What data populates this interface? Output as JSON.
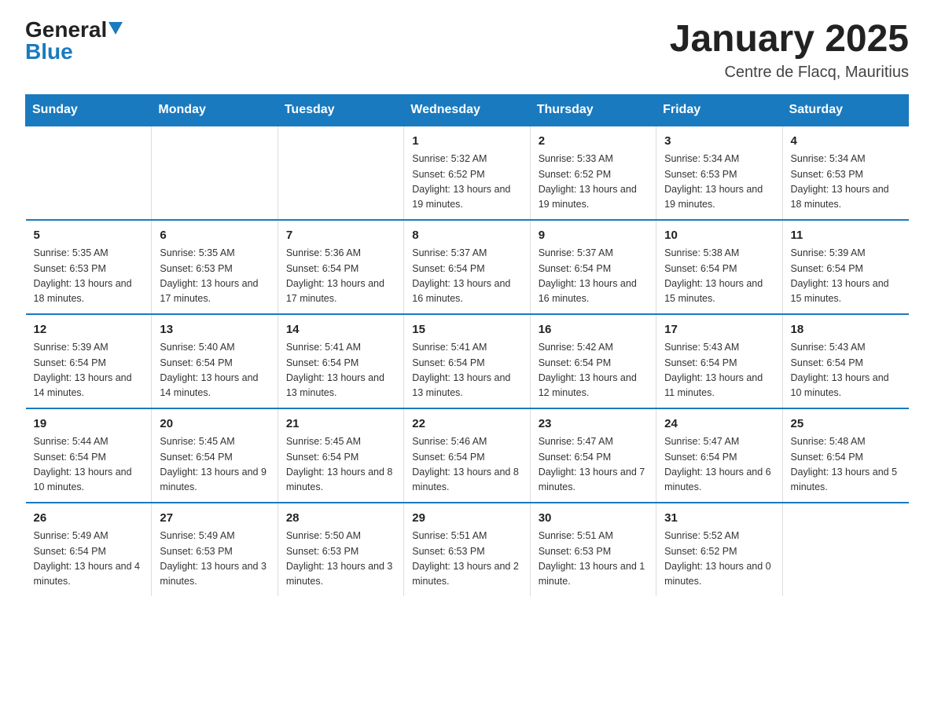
{
  "header": {
    "logo_general": "General",
    "logo_blue": "Blue",
    "title": "January 2025",
    "subtitle": "Centre de Flacq, Mauritius"
  },
  "days_of_week": [
    "Sunday",
    "Monday",
    "Tuesday",
    "Wednesday",
    "Thursday",
    "Friday",
    "Saturday"
  ],
  "weeks": [
    [
      {
        "day": "",
        "info": ""
      },
      {
        "day": "",
        "info": ""
      },
      {
        "day": "",
        "info": ""
      },
      {
        "day": "1",
        "info": "Sunrise: 5:32 AM\nSunset: 6:52 PM\nDaylight: 13 hours and 19 minutes."
      },
      {
        "day": "2",
        "info": "Sunrise: 5:33 AM\nSunset: 6:52 PM\nDaylight: 13 hours and 19 minutes."
      },
      {
        "day": "3",
        "info": "Sunrise: 5:34 AM\nSunset: 6:53 PM\nDaylight: 13 hours and 19 minutes."
      },
      {
        "day": "4",
        "info": "Sunrise: 5:34 AM\nSunset: 6:53 PM\nDaylight: 13 hours and 18 minutes."
      }
    ],
    [
      {
        "day": "5",
        "info": "Sunrise: 5:35 AM\nSunset: 6:53 PM\nDaylight: 13 hours and 18 minutes."
      },
      {
        "day": "6",
        "info": "Sunrise: 5:35 AM\nSunset: 6:53 PM\nDaylight: 13 hours and 17 minutes."
      },
      {
        "day": "7",
        "info": "Sunrise: 5:36 AM\nSunset: 6:54 PM\nDaylight: 13 hours and 17 minutes."
      },
      {
        "day": "8",
        "info": "Sunrise: 5:37 AM\nSunset: 6:54 PM\nDaylight: 13 hours and 16 minutes."
      },
      {
        "day": "9",
        "info": "Sunrise: 5:37 AM\nSunset: 6:54 PM\nDaylight: 13 hours and 16 minutes."
      },
      {
        "day": "10",
        "info": "Sunrise: 5:38 AM\nSunset: 6:54 PM\nDaylight: 13 hours and 15 minutes."
      },
      {
        "day": "11",
        "info": "Sunrise: 5:39 AM\nSunset: 6:54 PM\nDaylight: 13 hours and 15 minutes."
      }
    ],
    [
      {
        "day": "12",
        "info": "Sunrise: 5:39 AM\nSunset: 6:54 PM\nDaylight: 13 hours and 14 minutes."
      },
      {
        "day": "13",
        "info": "Sunrise: 5:40 AM\nSunset: 6:54 PM\nDaylight: 13 hours and 14 minutes."
      },
      {
        "day": "14",
        "info": "Sunrise: 5:41 AM\nSunset: 6:54 PM\nDaylight: 13 hours and 13 minutes."
      },
      {
        "day": "15",
        "info": "Sunrise: 5:41 AM\nSunset: 6:54 PM\nDaylight: 13 hours and 13 minutes."
      },
      {
        "day": "16",
        "info": "Sunrise: 5:42 AM\nSunset: 6:54 PM\nDaylight: 13 hours and 12 minutes."
      },
      {
        "day": "17",
        "info": "Sunrise: 5:43 AM\nSunset: 6:54 PM\nDaylight: 13 hours and 11 minutes."
      },
      {
        "day": "18",
        "info": "Sunrise: 5:43 AM\nSunset: 6:54 PM\nDaylight: 13 hours and 10 minutes."
      }
    ],
    [
      {
        "day": "19",
        "info": "Sunrise: 5:44 AM\nSunset: 6:54 PM\nDaylight: 13 hours and 10 minutes."
      },
      {
        "day": "20",
        "info": "Sunrise: 5:45 AM\nSunset: 6:54 PM\nDaylight: 13 hours and 9 minutes."
      },
      {
        "day": "21",
        "info": "Sunrise: 5:45 AM\nSunset: 6:54 PM\nDaylight: 13 hours and 8 minutes."
      },
      {
        "day": "22",
        "info": "Sunrise: 5:46 AM\nSunset: 6:54 PM\nDaylight: 13 hours and 8 minutes."
      },
      {
        "day": "23",
        "info": "Sunrise: 5:47 AM\nSunset: 6:54 PM\nDaylight: 13 hours and 7 minutes."
      },
      {
        "day": "24",
        "info": "Sunrise: 5:47 AM\nSunset: 6:54 PM\nDaylight: 13 hours and 6 minutes."
      },
      {
        "day": "25",
        "info": "Sunrise: 5:48 AM\nSunset: 6:54 PM\nDaylight: 13 hours and 5 minutes."
      }
    ],
    [
      {
        "day": "26",
        "info": "Sunrise: 5:49 AM\nSunset: 6:54 PM\nDaylight: 13 hours and 4 minutes."
      },
      {
        "day": "27",
        "info": "Sunrise: 5:49 AM\nSunset: 6:53 PM\nDaylight: 13 hours and 3 minutes."
      },
      {
        "day": "28",
        "info": "Sunrise: 5:50 AM\nSunset: 6:53 PM\nDaylight: 13 hours and 3 minutes."
      },
      {
        "day": "29",
        "info": "Sunrise: 5:51 AM\nSunset: 6:53 PM\nDaylight: 13 hours and 2 minutes."
      },
      {
        "day": "30",
        "info": "Sunrise: 5:51 AM\nSunset: 6:53 PM\nDaylight: 13 hours and 1 minute."
      },
      {
        "day": "31",
        "info": "Sunrise: 5:52 AM\nSunset: 6:52 PM\nDaylight: 13 hours and 0 minutes."
      },
      {
        "day": "",
        "info": ""
      }
    ]
  ]
}
